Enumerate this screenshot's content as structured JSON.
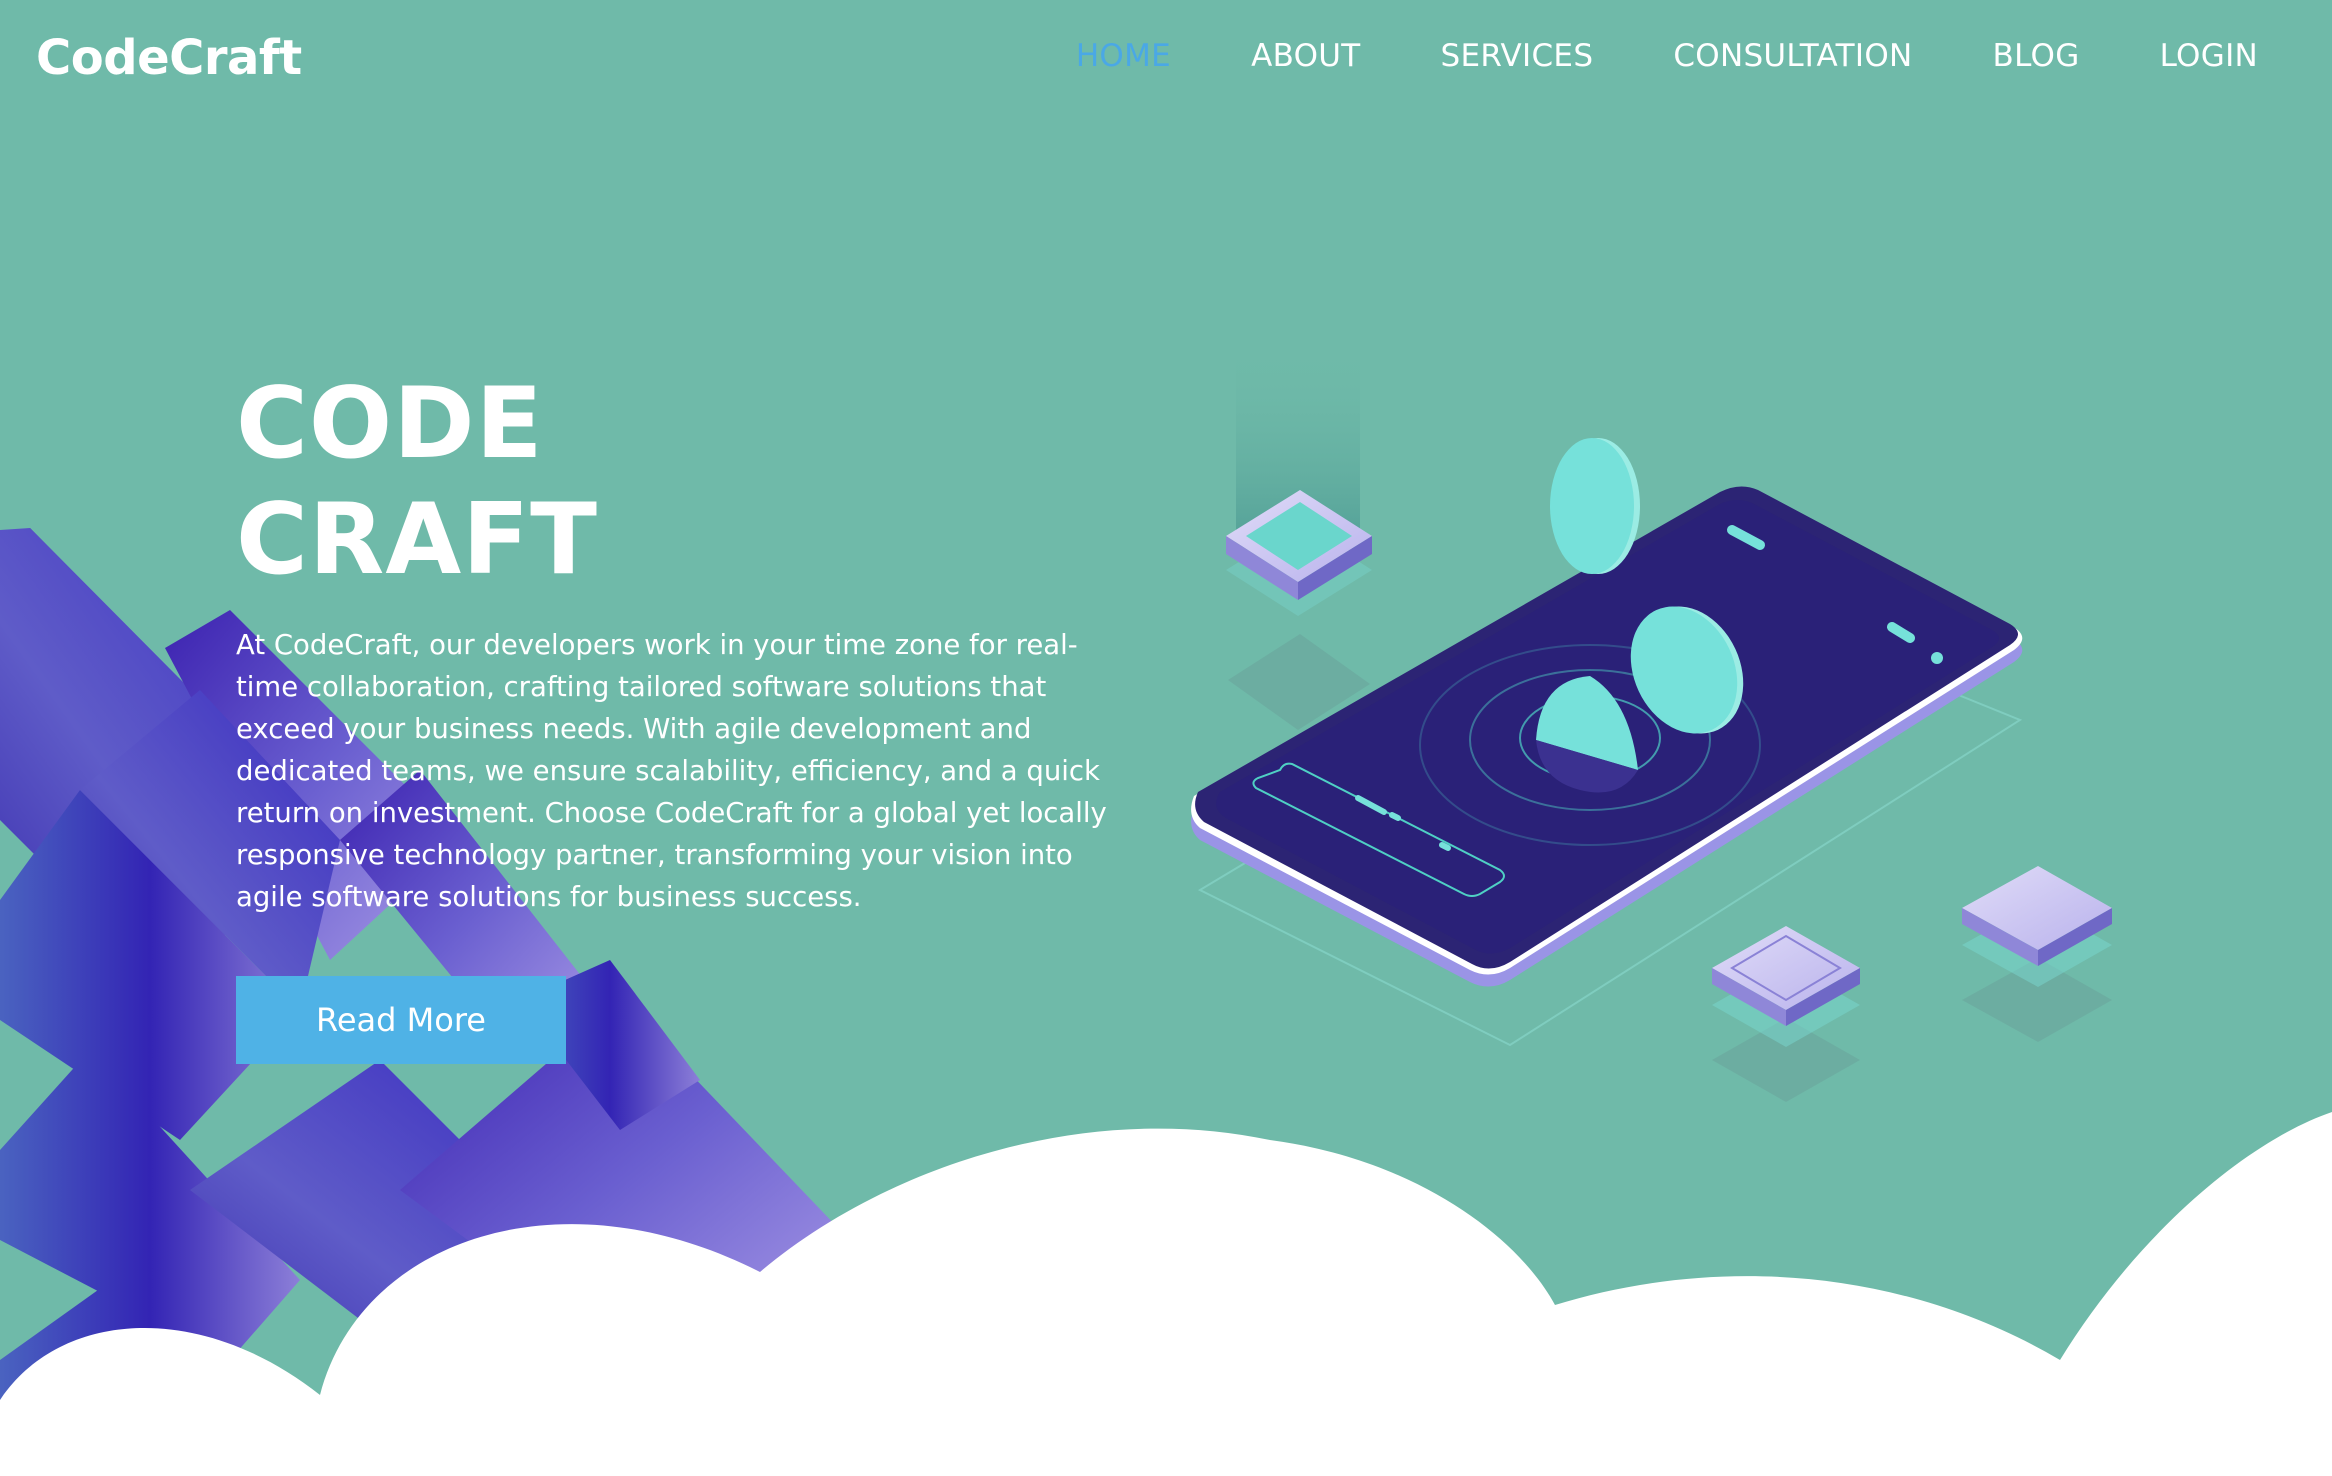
{
  "header": {
    "logo": "CodeCraft",
    "nav": [
      {
        "label": "HOME",
        "active": true
      },
      {
        "label": "ABOUT",
        "active": false
      },
      {
        "label": "SERVICES",
        "active": false
      },
      {
        "label": "CONSULTATION",
        "active": false
      },
      {
        "label": "BLOG",
        "active": false
      },
      {
        "label": "LOGIN",
        "active": false
      }
    ]
  },
  "hero": {
    "title_line1": "CODE",
    "title_line2": "CRAFT",
    "description": "At CodeCraft, our developers work in your time zone for real-time collaboration, crafting tailored software solutions that exceed your business needs. With agile development and dedicated teams, we ensure scalability, efficiency, and a quick return on investment. Choose CodeCraft for a global yet locally responsive technology partner, transforming your vision into agile software solutions for business success.",
    "cta_label": "Read More"
  },
  "colors": {
    "background": "#6fbaa9",
    "nav_active": "#4aa8e6",
    "button": "#4fb2e6",
    "phone_body": "#2c2474",
    "accent_mint": "#76e1da",
    "cloud": "#ffffff"
  }
}
